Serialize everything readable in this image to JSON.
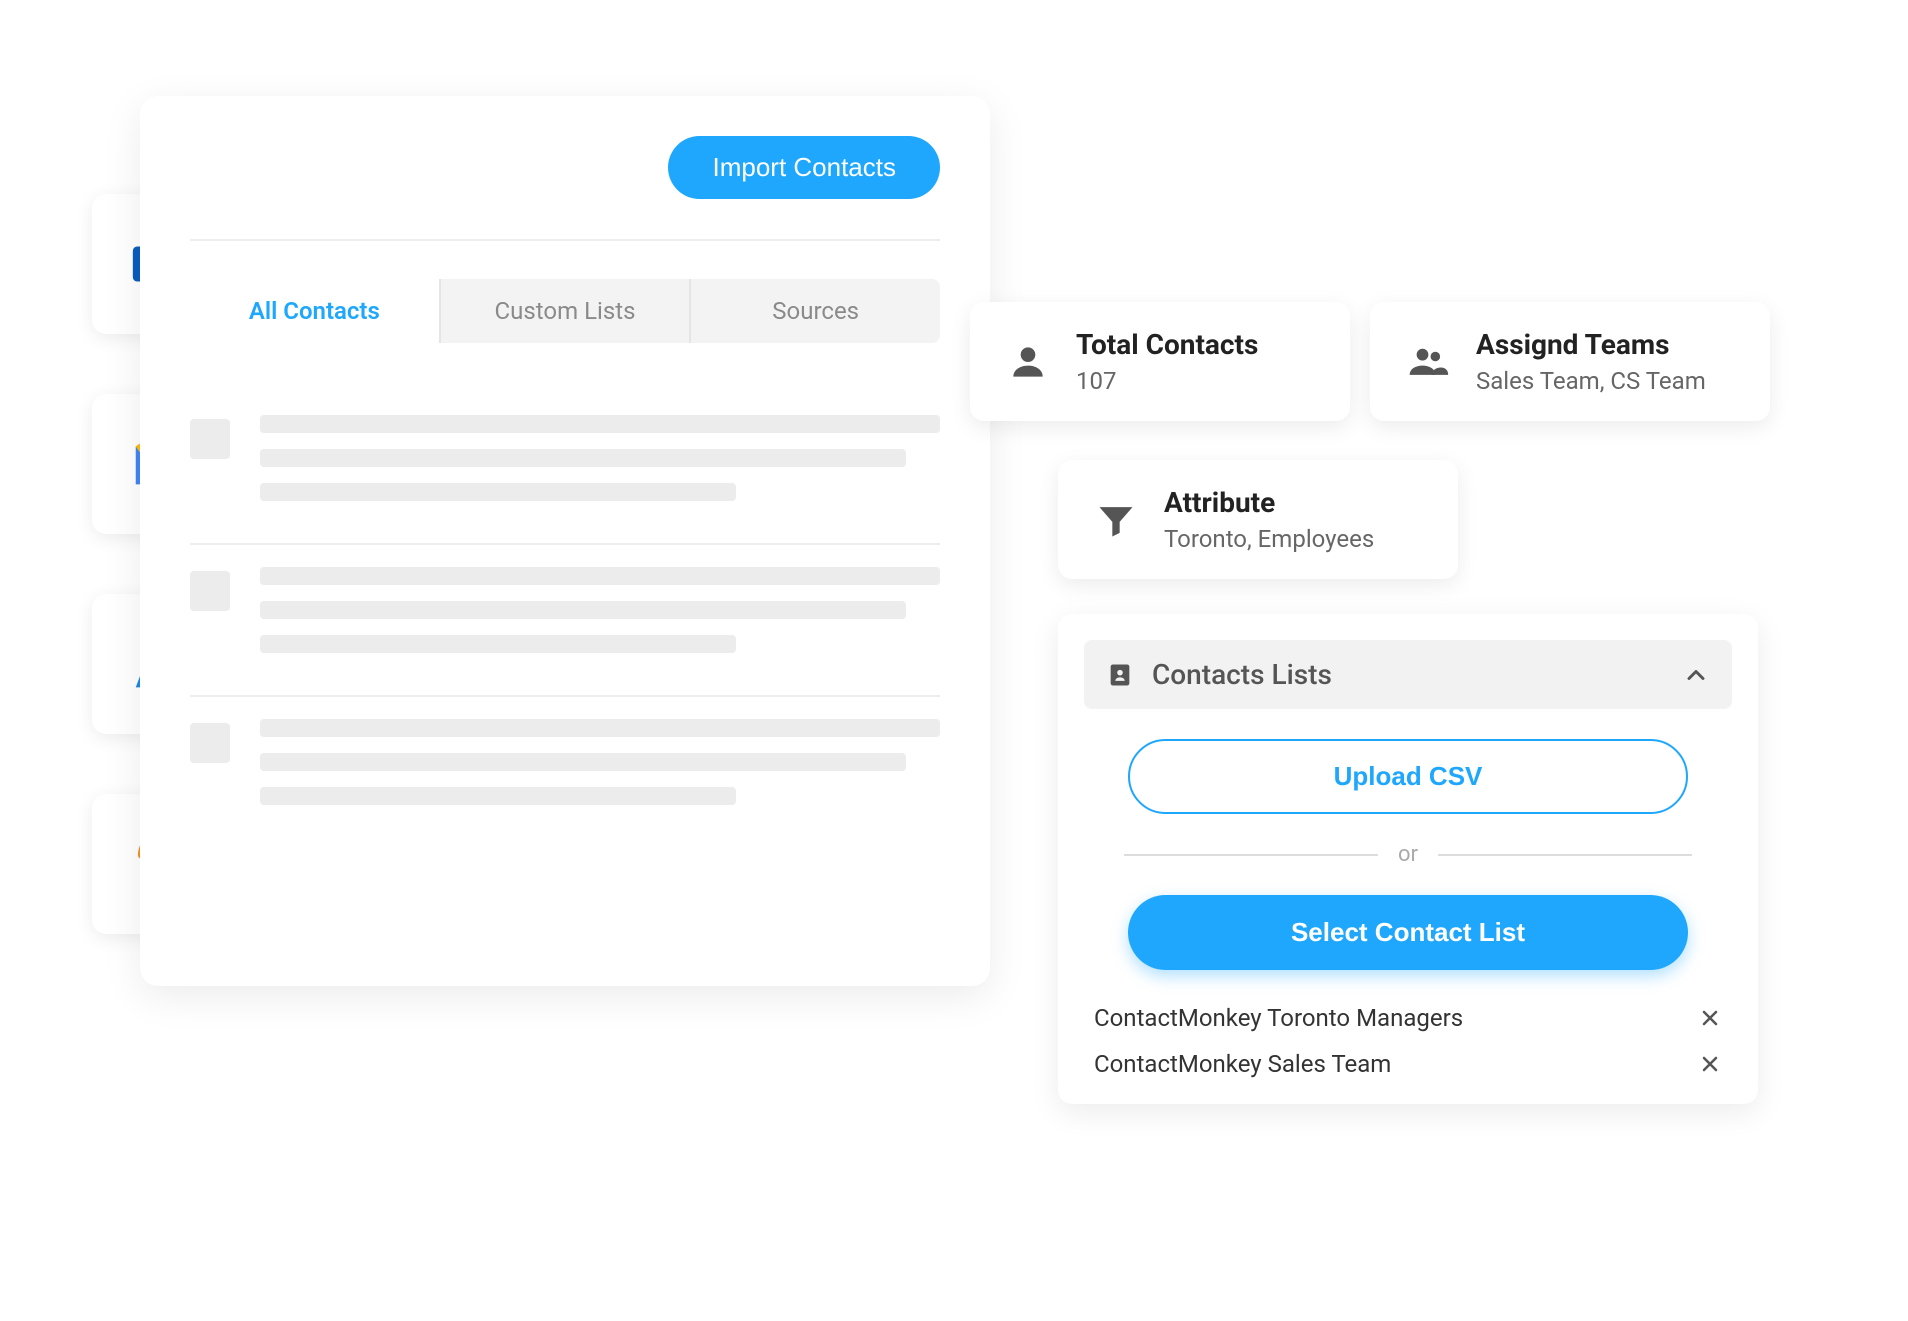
{
  "integrations": [
    {
      "name": "outlook"
    },
    {
      "name": "gmail"
    },
    {
      "name": "azure"
    },
    {
      "name": "workday"
    }
  ],
  "main": {
    "import_button": "Import Contacts",
    "tabs": [
      {
        "label": "All Contacts",
        "active": true
      },
      {
        "label": "Custom Lists",
        "active": false
      },
      {
        "label": "Sources",
        "active": false
      }
    ]
  },
  "summary": {
    "total": {
      "title": "Total Contacts",
      "value": "107"
    },
    "teams": {
      "title": "Assignd Teams",
      "value": "Sales Team, CS Team"
    },
    "attribute": {
      "title": "Attribute",
      "value": "Toronto, Employees"
    }
  },
  "lists_panel": {
    "header_title": "Contacts Lists",
    "upload_label": "Upload CSV",
    "or_label": "or",
    "select_label": "Select Contact List",
    "selected": [
      {
        "label": "ContactMonkey Toronto Managers"
      },
      {
        "label": "ContactMonkey Sales Team"
      }
    ]
  }
}
